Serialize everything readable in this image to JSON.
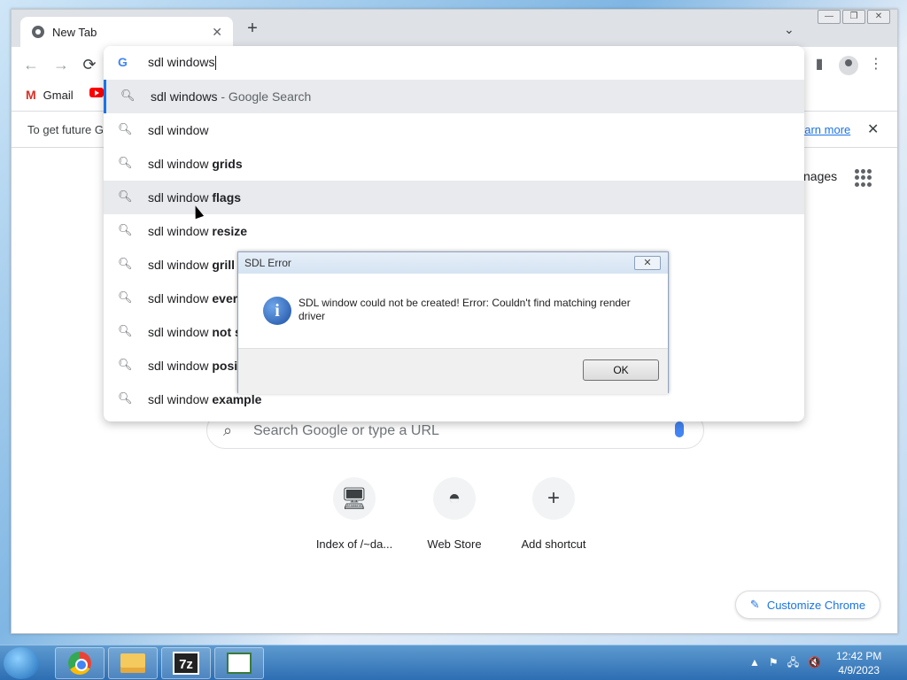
{
  "browser": {
    "tab_title": "New Tab",
    "infobar": {
      "text": "To get future G",
      "learn_more": "earn more"
    },
    "bookmarks": [
      {
        "label": "Gmail"
      }
    ],
    "images_link": "nages",
    "search_placeholder": "Search Google or type a URL",
    "shortcuts": [
      {
        "label": "Index of /~da..."
      },
      {
        "label": "Web Store"
      },
      {
        "label": "Add shortcut"
      }
    ],
    "customize_label": "Customize Chrome"
  },
  "omnibox": {
    "value": "sdl windows",
    "suggestions": [
      {
        "text": "sdl windows",
        "suffix": " - Google Search",
        "bold": ""
      },
      {
        "text": "sdl window",
        "suffix": "",
        "bold": ""
      },
      {
        "text": "sdl window ",
        "suffix": "",
        "bold": "grids"
      },
      {
        "text": "sdl window ",
        "suffix": "",
        "bold": "flags"
      },
      {
        "text": "sdl window ",
        "suffix": "",
        "bold": "resize"
      },
      {
        "text": "sdl window ",
        "suffix": "",
        "bold": "grill"
      },
      {
        "text": "sdl window ",
        "suffix": "",
        "bold": "ever"
      },
      {
        "text": "sdl window ",
        "suffix": "",
        "bold": "not s"
      },
      {
        "text": "sdl window ",
        "suffix": "",
        "bold": "posi"
      },
      {
        "text": "sdl window ",
        "suffix": "",
        "bold": "example"
      }
    ]
  },
  "dialog": {
    "title": "SDL Error",
    "message": "SDL window could not be created! Error: Couldn't find matching render driver",
    "ok_label": "OK"
  },
  "taskbar": {
    "time": "12:42 PM",
    "date": "4/9/2023",
    "z7_label": "7z"
  }
}
